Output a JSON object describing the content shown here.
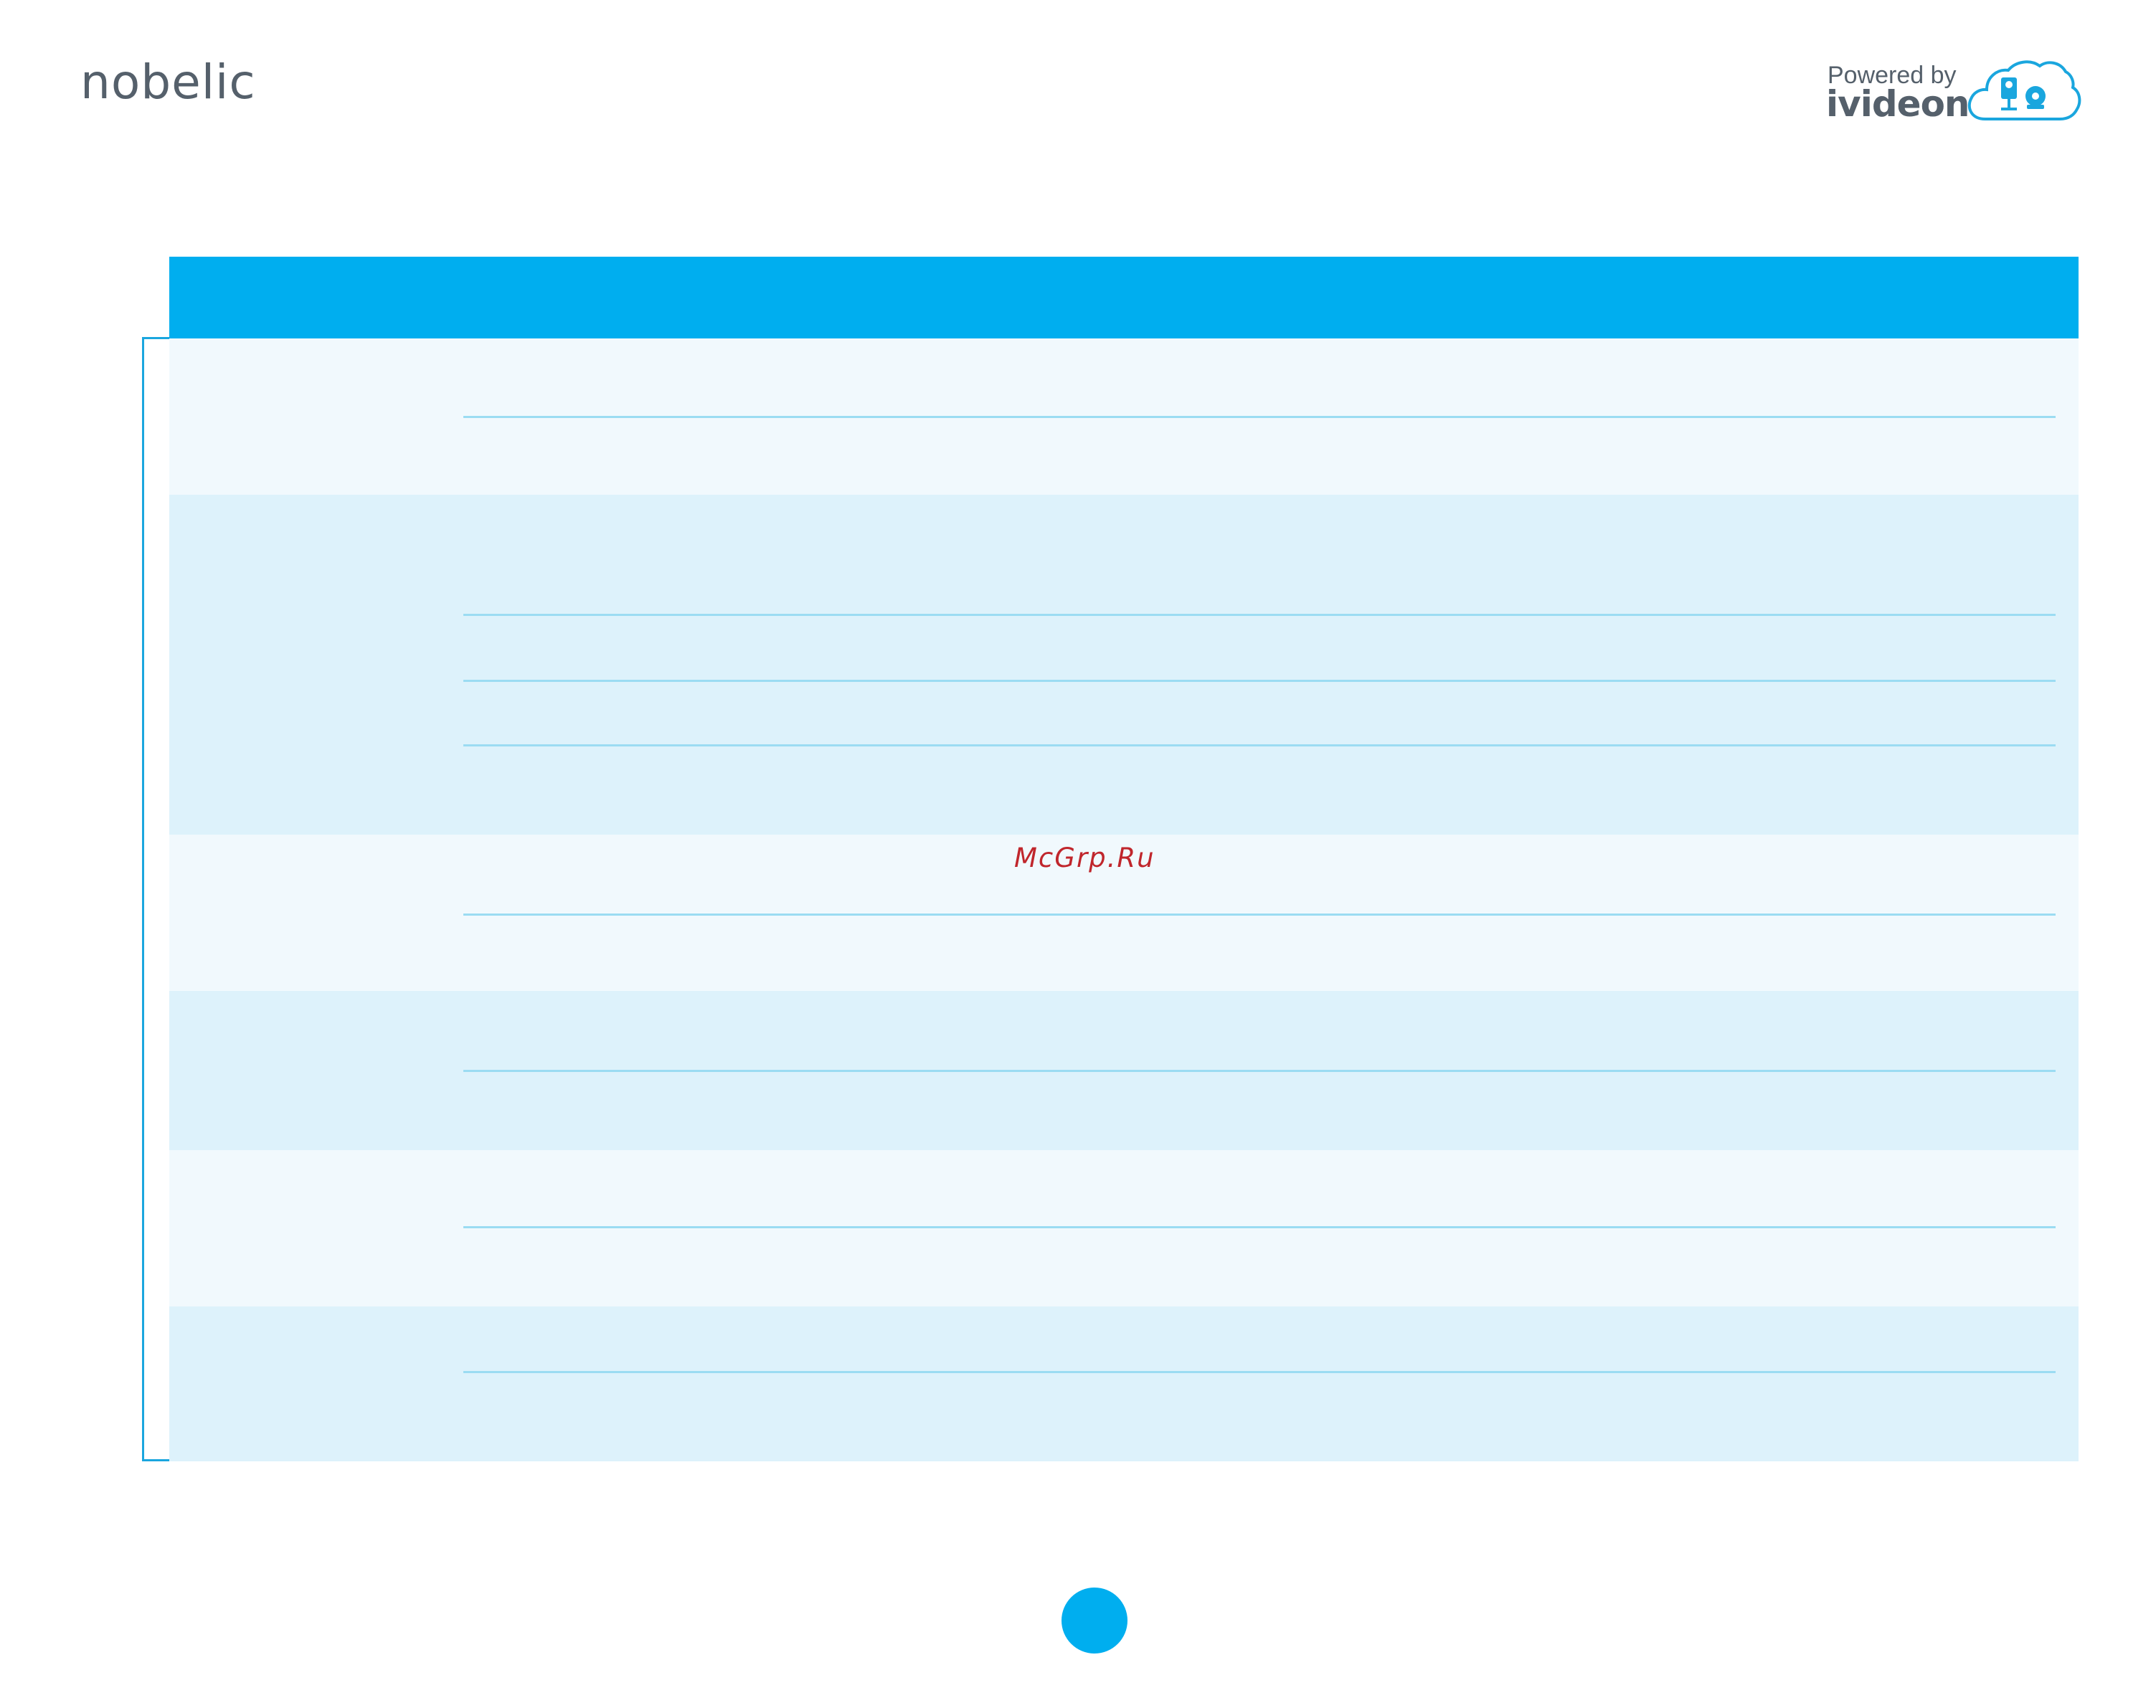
{
  "brand": {
    "logo_text": "nobelic",
    "powered_by": "Powered by",
    "partner_name": "ivideon",
    "cloud_icon": "cloud-camera-icon"
  },
  "table": {
    "header_color": "#00aeef",
    "row_colors": [
      "#f1f9fd",
      "#ddf2fb"
    ],
    "groups": [
      {
        "id": 1,
        "sub_rows": 2
      },
      {
        "id": 2,
        "sub_rows": 4
      },
      {
        "id": 3,
        "sub_rows": 2
      },
      {
        "id": 4,
        "sub_rows": 2
      },
      {
        "id": 5,
        "sub_rows": 2
      },
      {
        "id": 6,
        "sub_rows": 2
      }
    ]
  },
  "watermark": {
    "text": "McGrp.Ru",
    "color": "#c0262c"
  },
  "page": {
    "number": ""
  }
}
